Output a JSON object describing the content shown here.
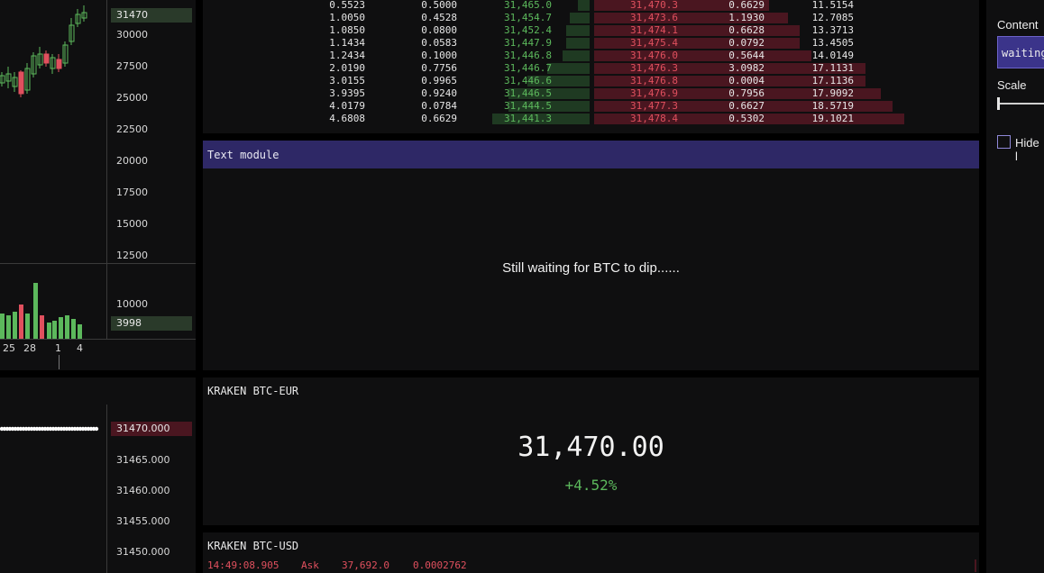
{
  "chart_top": {
    "price_ticks": [
      "30000",
      "27500",
      "25000",
      "22500",
      "20000",
      "17500",
      "15000",
      "12500"
    ],
    "price_tag": "31470",
    "volume_ticks": [
      "10000"
    ],
    "volume_tag": "3998",
    "date_ticks": [
      "25",
      "28",
      "1",
      "4"
    ]
  },
  "chart_bottom": {
    "price_ticks": [
      "31465.000",
      "31460.000",
      "31455.000",
      "31450.000"
    ],
    "price_tag": "31470.000"
  },
  "orderbook": {
    "rows": [
      {
        "bid_total": "0.5523",
        "bid_size": "0.5000",
        "bid_price": "31,465.0",
        "ask_price": "31,470.3",
        "ask_size": "0.6629",
        "ask_total": "11.5154",
        "bid_depth": 0.03,
        "ask_depth": 0.45
      },
      {
        "bid_total": "1.0050",
        "bid_size": "0.4528",
        "bid_price": "31,454.7",
        "ask_price": "31,473.6",
        "ask_size": "1.1930",
        "ask_total": "12.7085",
        "bid_depth": 0.05,
        "ask_depth": 0.5
      },
      {
        "bid_total": "1.0850",
        "bid_size": "0.0800",
        "bid_price": "31,452.4",
        "ask_price": "31,474.1",
        "ask_size": "0.6628",
        "ask_total": "13.3713",
        "bid_depth": 0.06,
        "ask_depth": 0.53
      },
      {
        "bid_total": "1.1434",
        "bid_size": "0.0583",
        "bid_price": "31,447.9",
        "ask_price": "31,475.4",
        "ask_size": "0.0792",
        "ask_total": "13.4505",
        "bid_depth": 0.06,
        "ask_depth": 0.53
      },
      {
        "bid_total": "1.2434",
        "bid_size": "0.1000",
        "bid_price": "31,446.8",
        "ask_price": "31,476.0",
        "ask_size": "0.5644",
        "ask_total": "14.0149",
        "bid_depth": 0.07,
        "ask_depth": 0.56
      },
      {
        "bid_total": "2.0190",
        "bid_size": "0.7756",
        "bid_price": "31,446.7",
        "ask_price": "31,476.3",
        "ask_size": "3.0982",
        "ask_total": "17.1131",
        "bid_depth": 0.11,
        "ask_depth": 0.7
      },
      {
        "bid_total": "3.0155",
        "bid_size": "0.9965",
        "bid_price": "31,446.6",
        "ask_price": "31,476.8",
        "ask_size": "0.0004",
        "ask_total": "17.1136",
        "bid_depth": 0.16,
        "ask_depth": 0.7
      },
      {
        "bid_total": "3.9395",
        "bid_size": "0.9240",
        "bid_price": "31,446.5",
        "ask_price": "31,476.9",
        "ask_size": "0.7956",
        "ask_total": "17.9092",
        "bid_depth": 0.21,
        "ask_depth": 0.74
      },
      {
        "bid_total": "4.0179",
        "bid_size": "0.0784",
        "bid_price": "31,444.5",
        "ask_price": "31,477.3",
        "ask_size": "0.6627",
        "ask_total": "18.5719",
        "bid_depth": 0.21,
        "ask_depth": 0.77
      },
      {
        "bid_total": "4.6808",
        "bid_size": "0.6629",
        "bid_price": "31,441.3",
        "ask_price": "31,478.4",
        "ask_size": "0.5302",
        "ask_total": "19.1021",
        "bid_depth": 0.25,
        "ask_depth": 0.8
      }
    ]
  },
  "text_module": {
    "title": "Text module",
    "content": "Still waiting for BTC to dip......"
  },
  "ticker": {
    "title": "KRAKEN BTC-EUR",
    "price": "31,470.00",
    "change": "+4.52%"
  },
  "trades": {
    "title": "KRAKEN BTC-USD",
    "rows": [
      {
        "time": "14:49:08.905",
        "side": "Ask",
        "price": "37,692.0",
        "size": "0.0002762"
      }
    ]
  },
  "sidebar": {
    "content_label": "Content",
    "content_value": "waiting",
    "scale_label": "Scale",
    "scale_value": 0.0,
    "hide_label": "Hide l"
  },
  "colors": {
    "bid": "#5cb85c",
    "ask": "#e0505e",
    "module_header": "#2e2866",
    "accent": "#3b348a"
  }
}
